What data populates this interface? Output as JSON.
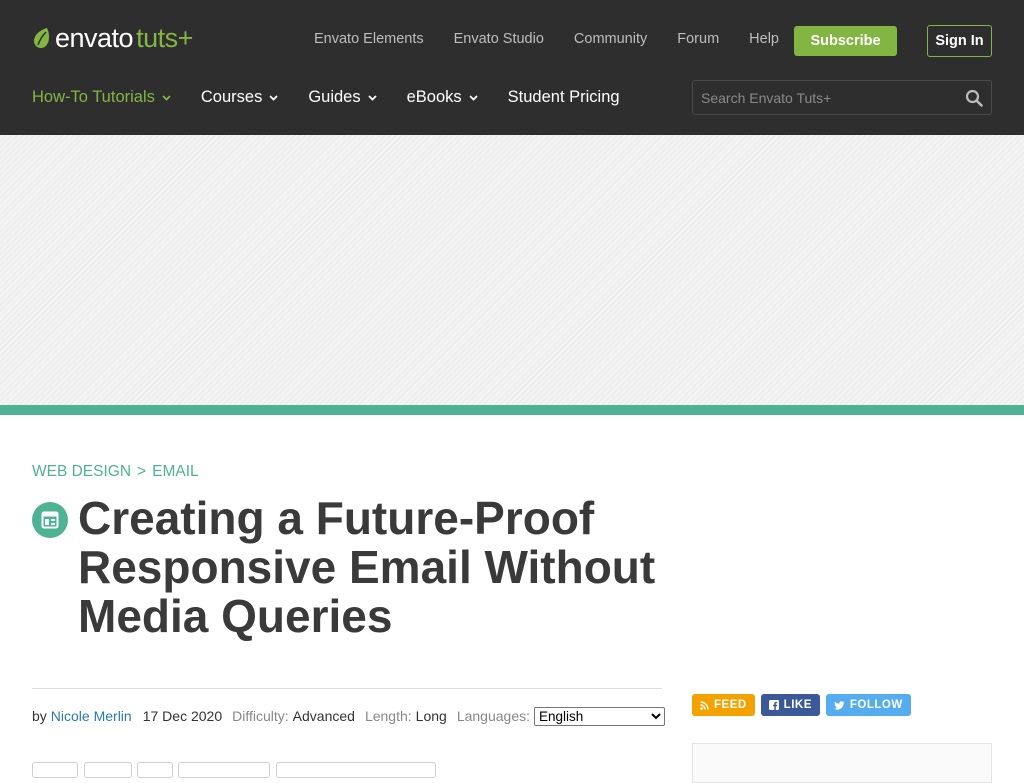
{
  "header": {
    "brand": "envato",
    "brand_suffix": "tuts+",
    "top_links": [
      "Envato Elements",
      "Envato Studio",
      "Community",
      "Forum",
      "Help"
    ],
    "subscribe_label": "Subscribe",
    "signin_label": "Sign In",
    "main_nav": [
      {
        "label": "How-To Tutorials",
        "dropdown": true,
        "active": true
      },
      {
        "label": "Courses",
        "dropdown": true,
        "active": false
      },
      {
        "label": "Guides",
        "dropdown": true,
        "active": false
      },
      {
        "label": "eBooks",
        "dropdown": true,
        "active": false
      },
      {
        "label": "Student Pricing",
        "dropdown": false,
        "active": false
      }
    ],
    "search_placeholder": "Search Envato Tuts+"
  },
  "article": {
    "breadcrumb": [
      "WEB DESIGN",
      "EMAIL"
    ],
    "breadcrumb_separator": ">",
    "category_icon": "layout-icon",
    "title": "Creating a Future-Proof Responsive Email Without Media Queries",
    "meta": {
      "by_label": "by",
      "author": "Nicole Merlin",
      "date": "17 Dec 2020",
      "difficulty_label": "Difficulty:",
      "difficulty": "Advanced",
      "length_label": "Length:",
      "length": "Long",
      "languages_label": "Languages:",
      "language_selected": "English"
    }
  },
  "sidebar": {
    "social": [
      {
        "label": "FEED",
        "icon": "rss-icon",
        "color": "#f4a200"
      },
      {
        "label": "LIKE",
        "icon": "facebook-icon",
        "color": "#3b5998"
      },
      {
        "label": "FOLLOW",
        "icon": "twitter-icon",
        "color": "#55acee"
      }
    ]
  },
  "colors": {
    "header_bg": "#2e2e2e",
    "brand_green": "#82b541",
    "accent_teal": "#4eb393",
    "link_blue": "#2a7ab0"
  }
}
